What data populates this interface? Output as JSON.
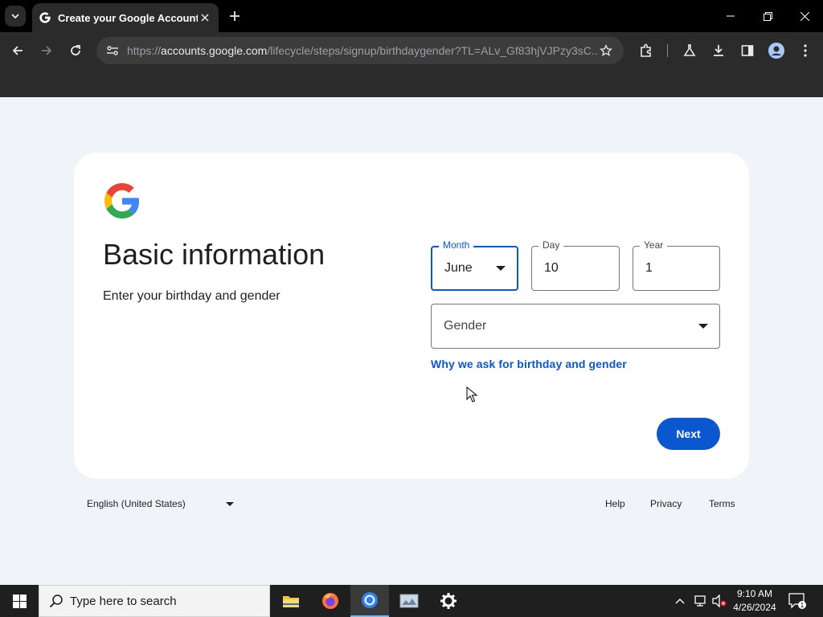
{
  "browser": {
    "tab_title": "Create your Google Account",
    "url_scheme": "https://",
    "url_host": "accounts.google.com",
    "url_path": "/lifecycle/steps/signup/birthdaygender?TL=ALv_Gf83hjVJPzy3sC..."
  },
  "page": {
    "heading": "Basic information",
    "subheading": "Enter your birthday and gender",
    "month": {
      "label": "Month",
      "value": "June"
    },
    "day": {
      "label": "Day",
      "value": "10"
    },
    "year": {
      "label": "Year",
      "value": "1"
    },
    "gender": {
      "placeholder": "Gender"
    },
    "why_link": "Why we ask for birthday and gender",
    "next_label": "Next"
  },
  "footer": {
    "language": "English (United States)",
    "help": "Help",
    "privacy": "Privacy",
    "terms": "Terms"
  },
  "taskbar": {
    "search_placeholder": "Type here to search",
    "time": "9:10 AM",
    "date": "4/26/2024",
    "notification_count": "1"
  },
  "colors": {
    "accent": "#0b57d0",
    "page_bg": "#f0f4f9",
    "chrome_dark": "#2b2b2b"
  }
}
